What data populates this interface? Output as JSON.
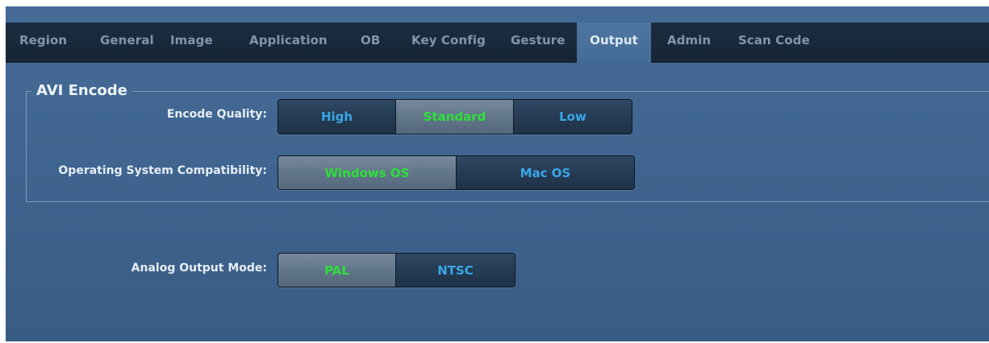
{
  "tabs": [
    {
      "label": "Region",
      "active": false
    },
    {
      "label": "General",
      "active": false
    },
    {
      "label": "Image",
      "active": false
    },
    {
      "label": "Application",
      "active": false
    },
    {
      "label": "OB",
      "active": false
    },
    {
      "label": "Key Config",
      "active": false
    },
    {
      "label": "Gesture",
      "active": false
    },
    {
      "label": "Output",
      "active": true
    },
    {
      "label": "Admin",
      "active": false
    },
    {
      "label": "Scan Code",
      "active": false
    }
  ],
  "avi_encode": {
    "title": "AVI Encode",
    "encode_quality": {
      "label": "Encode Quality:",
      "options": [
        "High",
        "Standard",
        "Low"
      ],
      "selected": "Standard"
    },
    "os_compatibility": {
      "label": "Operating System Compatibility:",
      "options": [
        "Windows OS",
        "Mac OS"
      ],
      "selected": "Windows OS"
    }
  },
  "analog_output": {
    "label": "Analog Output Mode:",
    "options": [
      "PAL",
      "NTSC"
    ],
    "selected": "PAL"
  },
  "colors": {
    "panel_background": "#3f6590",
    "tab_bar": "#152536",
    "selected_option_text": "#2ee03a",
    "unselected_option_text": "#3aa7e6"
  }
}
